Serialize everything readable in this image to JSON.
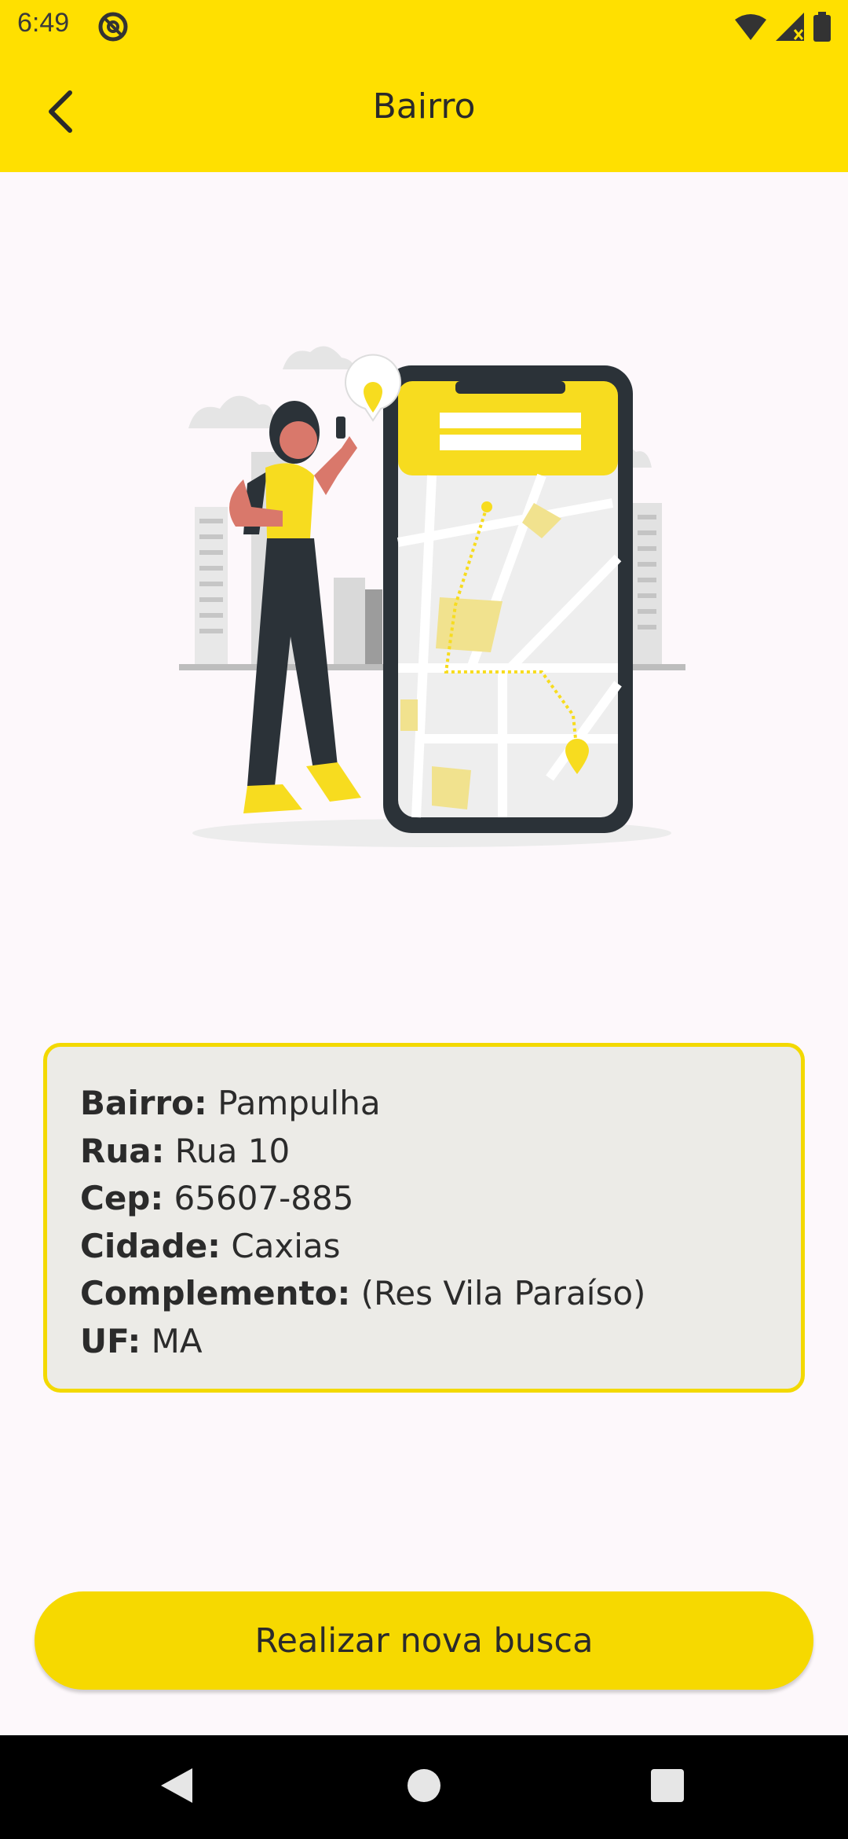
{
  "status": {
    "time": "6:49"
  },
  "header": {
    "title": "Bairro",
    "back_icon": "back-arrow-icon"
  },
  "details": {
    "bairro": {
      "label": "Bairro:",
      "value": "Pampulha"
    },
    "rua": {
      "label": "Rua:",
      "value": "Rua 10"
    },
    "cep": {
      "label": "Cep:",
      "value": "65607-885"
    },
    "cidade": {
      "label": "Cidade:",
      "value": "Caxias"
    },
    "complemento": {
      "label": "Complemento:",
      "value": "(Res Vila Paraíso)"
    },
    "uf": {
      "label": "UF:",
      "value": "MA"
    }
  },
  "actions": {
    "new_search_label": "Realizar nova busca"
  },
  "colors": {
    "accent": "#ffe000",
    "button": "#f6d900",
    "card_bg": "#ecebe7",
    "card_border": "#f3d900"
  }
}
